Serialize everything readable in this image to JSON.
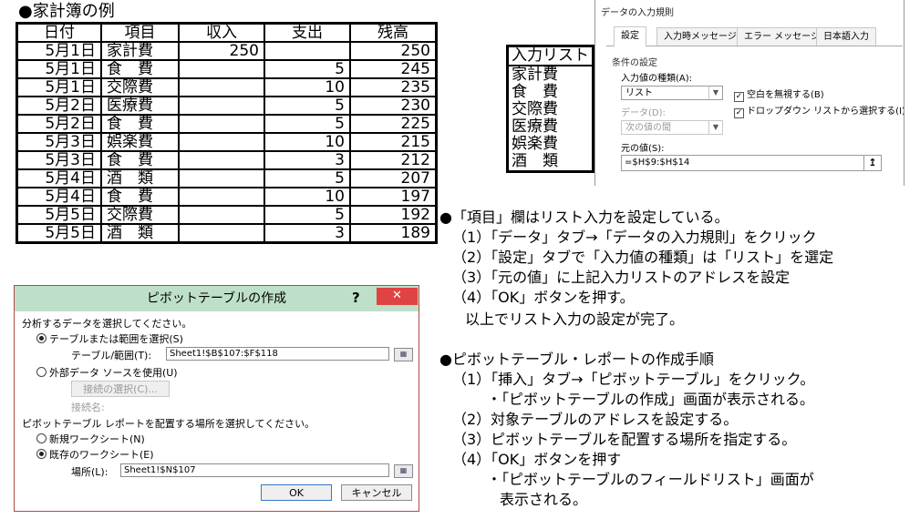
{
  "ledger": {
    "title": "●家計簿の例",
    "headers": [
      "日付",
      "項目",
      "収入",
      "支出",
      "残高"
    ],
    "rows": [
      {
        "date": "5月1日",
        "item": "家計費",
        "income": "250",
        "expense": "",
        "balance": "250"
      },
      {
        "date": "5月1日",
        "item": "食　費",
        "income": "",
        "expense": "5",
        "balance": "245"
      },
      {
        "date": "5月1日",
        "item": "交際費",
        "income": "",
        "expense": "10",
        "balance": "235"
      },
      {
        "date": "5月2日",
        "item": "医療費",
        "income": "",
        "expense": "5",
        "balance": "230"
      },
      {
        "date": "5月2日",
        "item": "食　費",
        "income": "",
        "expense": "5",
        "balance": "225"
      },
      {
        "date": "5月3日",
        "item": "娯楽費",
        "income": "",
        "expense": "10",
        "balance": "215"
      },
      {
        "date": "5月3日",
        "item": "食　費",
        "income": "",
        "expense": "3",
        "balance": "212"
      },
      {
        "date": "5月4日",
        "item": "酒　類",
        "income": "",
        "expense": "5",
        "balance": "207"
      },
      {
        "date": "5月4日",
        "item": "食　費",
        "income": "",
        "expense": "10",
        "balance": "197"
      },
      {
        "date": "5月5日",
        "item": "交際費",
        "income": "",
        "expense": "5",
        "balance": "192"
      },
      {
        "date": "5月5日",
        "item": "酒　類",
        "income": "",
        "expense": "3",
        "balance": "189"
      }
    ]
  },
  "input_list": {
    "header": "入力リスト",
    "items": [
      "家計費",
      "食　費",
      "交際費",
      "医療費",
      "娯楽費",
      "酒　類"
    ]
  },
  "validation_dialog": {
    "title": "データの入力規則",
    "tabs": [
      "設定",
      "入力時メッセージ",
      "エラー メッセージ",
      "日本語入力"
    ],
    "group_label": "条件の設定",
    "allow_label": "入力値の種類(A):",
    "allow_value": "リスト",
    "data_label": "データ(D):",
    "data_value": "次の値の間",
    "ignore_blank_label": "空白を無視する(B)",
    "dropdown_label": "ドロップダウン リストから選択する(I)",
    "source_label": "元の値(S):",
    "source_value": "=$H$9:$H$14",
    "source_button": "↥"
  },
  "pivot_dialog": {
    "title": "ピボットテーブルの作成",
    "help": "?",
    "close": "✕",
    "select_data_label": "分析するデータを選択してください。",
    "select_table_label": "テーブルまたは範囲を選択(S)",
    "table_range_label": "テーブル/範囲(T):",
    "table_range_value": "Sheet1!$B$107:$F$118",
    "external_source_label": "外部データ ソースを使用(U)",
    "choose_connection_label": "接続の選択(C)...",
    "connection_name_label": "接続名:",
    "placement_label": "ピボットテーブル レポートを配置する場所を選択してください。",
    "new_sheet_label": "新規ワークシート(N)",
    "existing_sheet_label": "既存のワークシート(E)",
    "location_label": "場所(L):",
    "location_value": "Sheet1!$N$107",
    "ok_label": "OK",
    "cancel_label": "キャンセル",
    "range_button": "▦"
  },
  "notes": {
    "list_title": "●「項目」欄はリスト入力を設定している。",
    "list_steps": [
      "（1）「データ」タブ→「データの入力規則」をクリック",
      "（2）「設定」タブで「入力値の種類」は「リスト」を選定",
      "（3）「元の値」に上記入力リストのアドレスを設定",
      "（4）「OK」ボタンを押す。",
      "以上でリスト入力の設定が完了。"
    ],
    "pivot_title": "●ピボットテーブル・レポートの作成手順",
    "pivot_steps": [
      "（1）「挿入」タブ→「ピボットテーブル」をクリック。",
      "・「ピボットテーブルの作成」画面が表示される。",
      "（2）対象テーブルのアドレスを設定する。",
      "（3）ピボットテーブルを配置する場所を指定する。",
      "（4）「OK」ボタンを押す",
      "・「ピボットテーブルのフィールドリスト」画面が",
      "表示される。"
    ]
  }
}
